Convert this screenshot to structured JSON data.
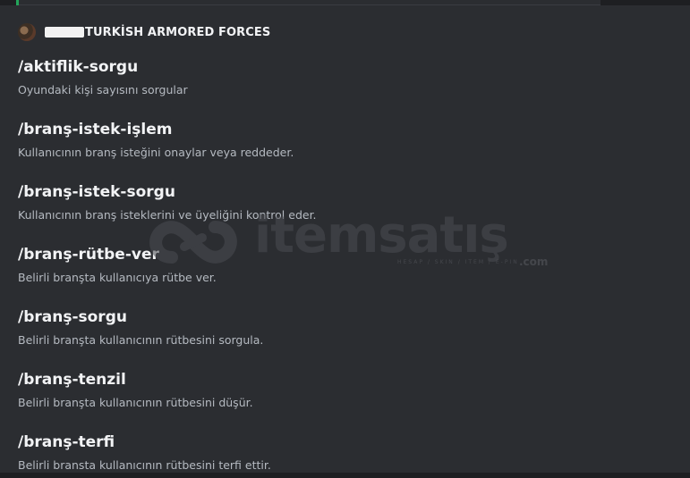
{
  "app": {
    "name": "TURKİSH ARMORED FORCES"
  },
  "commands": [
    {
      "name": "/aktiflik-sorgu",
      "description": "Oyundaki kişi sayısını sorgular"
    },
    {
      "name": "/branş-istek-işlem",
      "description": "Kullanıcının branş isteğini onaylar veya reddeder."
    },
    {
      "name": "/branş-istek-sorgu",
      "description": "Kullanıcının branş isteklerini ve üyeliğini kontrol eder."
    },
    {
      "name": "/branş-rütbe-ver",
      "description": "Belirli branşta kullanıcıya rütbe ver."
    },
    {
      "name": "/branş-sorgu",
      "description": "Belirli branşta kullanıcının rütbesini sorgula."
    },
    {
      "name": "/branş-tenzil",
      "description": "Belirli branşta kullanıcının rütbesini düşür."
    },
    {
      "name": "/branş-terfi",
      "description": "Belirli bransta kullanıcının rütbesini terfi ettir."
    }
  ],
  "watermark": {
    "brand": "itemsatış",
    "tagline": "HESAP / SKIN / ITEM / E-PIN",
    "suffix": ".com"
  }
}
